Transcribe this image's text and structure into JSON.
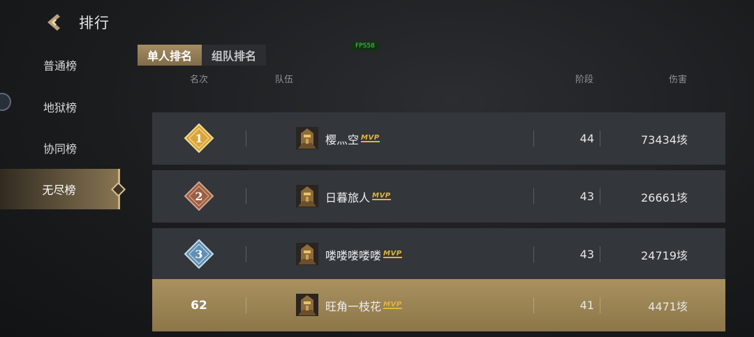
{
  "header": {
    "title": "排行"
  },
  "sidebar": {
    "items": [
      {
        "label": "普通榜",
        "active": false
      },
      {
        "label": "地狱榜",
        "active": false
      },
      {
        "label": "协同榜",
        "active": false
      },
      {
        "label": "无尽榜",
        "active": true
      }
    ]
  },
  "tabs": [
    {
      "label": "单人排名",
      "active": true
    },
    {
      "label": "组队排名",
      "active": false
    }
  ],
  "fps_badge": "FPS58",
  "columns": {
    "rank": "名次",
    "team": "队伍",
    "stage": "阶段",
    "damage": "伤害"
  },
  "mvp_label": "MVP",
  "rows": [
    {
      "rank": "1",
      "name": "樱灬空",
      "stage": "44",
      "damage": "73434垓",
      "medal_color": "#d9a53a"
    },
    {
      "rank": "2",
      "name": "日暮旅人",
      "stage": "43",
      "damage": "26661垓",
      "medal_color": "#9a5f45"
    },
    {
      "rank": "3",
      "name": "喽喽喽喽喽",
      "stage": "43",
      "damage": "24719垓",
      "medal_color": "#5f8fb3"
    },
    {
      "rank": "62",
      "name": "旺角一枝花",
      "stage": "41",
      "damage": "4471垓",
      "self": true
    }
  ],
  "colors": {
    "accent": "#a58d63",
    "mvp": "#e3b43c",
    "row_bg": "#33363a"
  }
}
